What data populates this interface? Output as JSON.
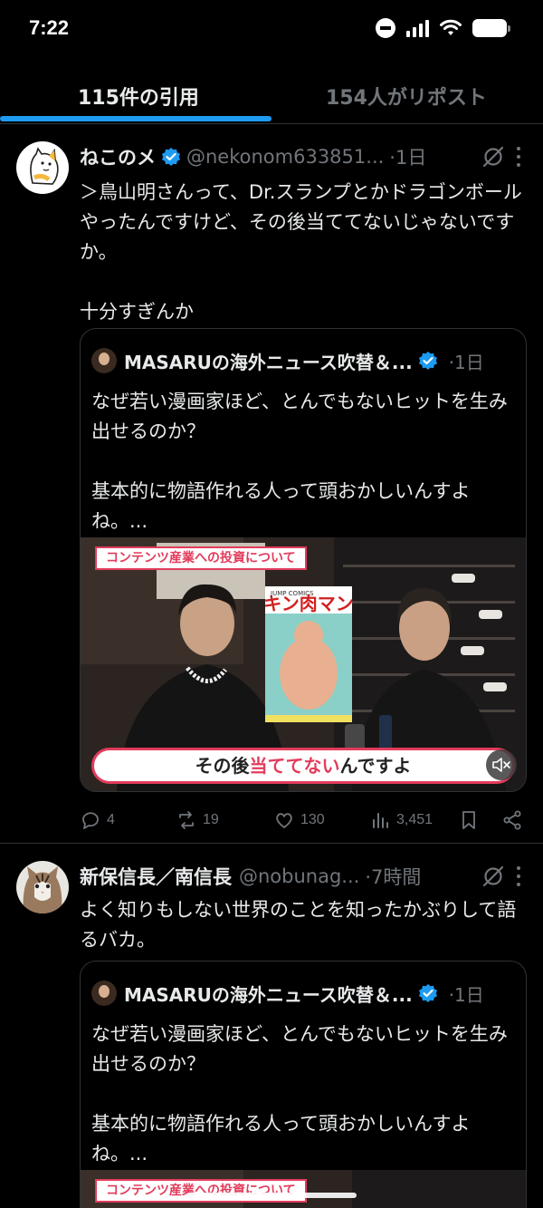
{
  "status_bar": {
    "time": "7:22"
  },
  "tabs": {
    "quotes": "115件の引用",
    "reposts": "154人がリポスト"
  },
  "posts": [
    {
      "name": "ねこのメ",
      "handle": "@nekonom633851...",
      "time": "·1日",
      "text": "＞鳥山明さんって、Dr.スランプとかドラゴンボールやったんですけど、その後当ててないじゃないですか。\n\n十分すぎんか",
      "quote": {
        "name": "MASARUの海外ニュース吹替＆...",
        "time": "·1日",
        "text": "なぜ若い漫画家ほど、とんでもないヒットを生み出せるのか？\n\n基本的に物語作れる人って頭おかしいんすよね。...",
        "media": {
          "banner": "コンテンツ産業への投資について",
          "caption_pre": "その後",
          "caption_highlight": "当ててない",
          "caption_post": "んですよ",
          "manga_title": "キン肉マン",
          "manga_label": "JUMP COMICS"
        }
      },
      "stats": {
        "replies": "4",
        "reposts": "19",
        "likes": "130",
        "views": "3,451"
      }
    },
    {
      "name": "新保信長／南信長",
      "handle": "@nobunag...",
      "time": "·7時間",
      "text": "よく知りもしない世界のことを知ったかぶりして語るバカ。",
      "quote": {
        "name": "MASARUの海外ニュース吹替＆...",
        "time": "·1日",
        "text": "なぜ若い漫画家ほど、とんでもないヒットを生み出せるのか？\n\n基本的に物語作れる人って頭おかしいんすよね。...",
        "media": {
          "banner": "コンテンツ産業への投資について"
        }
      }
    }
  ],
  "colors": {
    "accent": "#1d9bf0",
    "muted": "#71767b",
    "text": "#e7e9ea",
    "caption_red": "#e23c5c"
  }
}
